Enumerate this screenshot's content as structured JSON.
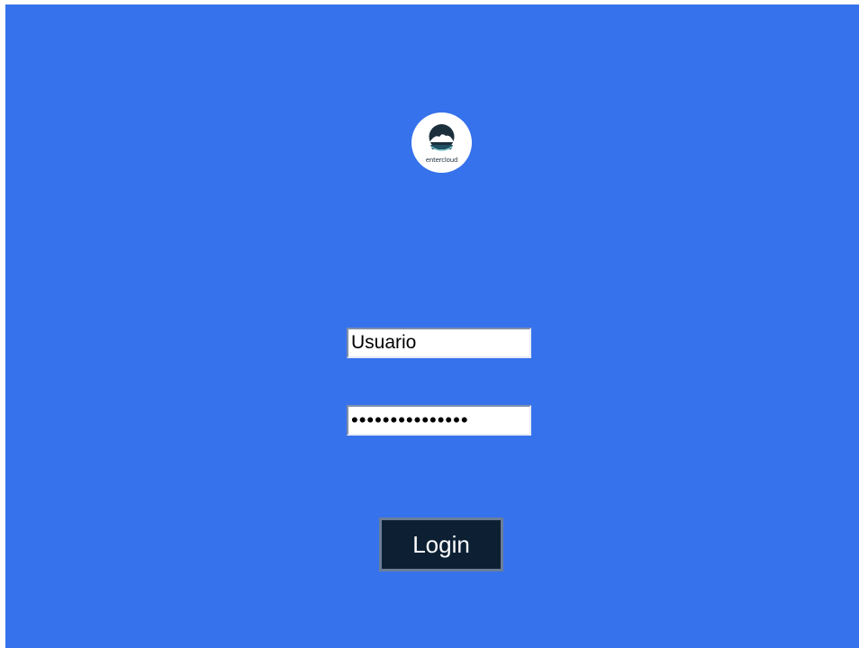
{
  "colors": {
    "background": "#3672ec",
    "button_bg": "#0d2033",
    "logo_accent": "#1f4f63"
  },
  "logo": {
    "text": "entercloud",
    "icon": "entercloud-logo-icon"
  },
  "form": {
    "username_value": "Usuario",
    "password_mask": "•••••••••••••••",
    "login_label": "Login"
  }
}
